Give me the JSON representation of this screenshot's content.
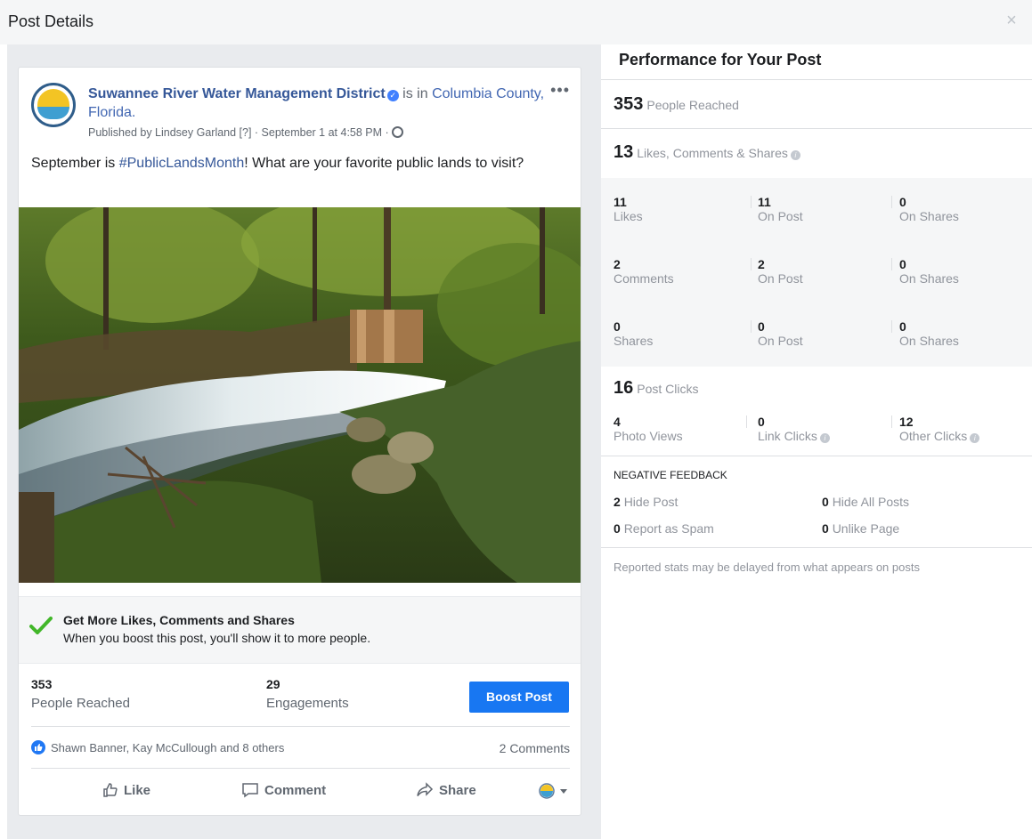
{
  "dialog": {
    "title": "Post Details",
    "close_label": "×"
  },
  "post": {
    "author": "Suwannee River Water Management District",
    "location_prefix": "is in",
    "location": "Columbia County, Florida.",
    "published": "Published by Lindsey Garland [?] · September 1 at 4:58 PM ·",
    "text_before": "September is ",
    "hashtag": "#PublicLandsMonth",
    "text_after": "! What are your favorite public lands to visit?",
    "more_label": "•••"
  },
  "promo": {
    "title": "Get More Likes, Comments and Shares",
    "subtitle": "When you boost this post, you'll show it to more people."
  },
  "summary": {
    "reached_value": "353",
    "reached_label": "People Reached",
    "engagements_value": "29",
    "engagements_label": "Engagements",
    "boost_label": "Boost Post"
  },
  "reactions": {
    "reactors": "Shawn Banner, Kay McCullough and 8 others",
    "comments": "2 Comments"
  },
  "actions": {
    "like": "Like",
    "comment": "Comment",
    "share": "Share"
  },
  "performance": {
    "title": "Performance for Your Post",
    "reached_value": "353",
    "reached_label": "People Reached",
    "engagement_value": "13",
    "engagement_label": "Likes, Comments & Shares",
    "rows": [
      {
        "total": "11",
        "total_label": "Likes",
        "on_post": "11",
        "on_post_label": "On Post",
        "on_shares": "0",
        "on_shares_label": "On Shares"
      },
      {
        "total": "2",
        "total_label": "Comments",
        "on_post": "2",
        "on_post_label": "On Post",
        "on_shares": "0",
        "on_shares_label": "On Shares"
      },
      {
        "total": "0",
        "total_label": "Shares",
        "on_post": "0",
        "on_post_label": "On Post",
        "on_shares": "0",
        "on_shares_label": "On Shares"
      }
    ],
    "clicks_value": "16",
    "clicks_label": "Post Clicks",
    "clicks": [
      {
        "value": "4",
        "label": "Photo Views"
      },
      {
        "value": "0",
        "label": "Link Clicks"
      },
      {
        "value": "12",
        "label": "Other Clicks"
      }
    ],
    "negative_title": "NEGATIVE FEEDBACK",
    "negative": [
      {
        "value": "2",
        "label": "Hide Post"
      },
      {
        "value": "0",
        "label": "Hide All Posts"
      },
      {
        "value": "0",
        "label": "Report as Spam"
      },
      {
        "value": "0",
        "label": "Unlike Page"
      }
    ],
    "disclaimer": "Reported stats may be delayed from what appears on posts"
  },
  "colors": {
    "accent": "#1877f2",
    "link": "#365899",
    "panel_gray": "#e9ebee"
  }
}
